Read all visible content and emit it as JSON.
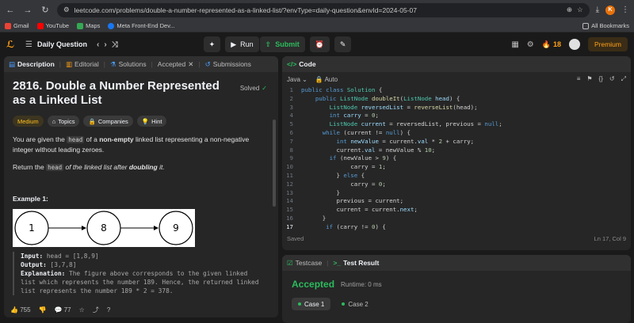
{
  "browser": {
    "url": "leetcode.com/problems/double-a-number-represented-as-a-linked-list/?envType=daily-question&envId=2024-05-07",
    "profile_initial": "K",
    "bookmarks": [
      "Gmail",
      "YouTube",
      "Maps",
      "Meta Front-End Dev..."
    ],
    "all_bookmarks": "All Bookmarks"
  },
  "header": {
    "daily_label": "Daily Question",
    "run_label": "Run",
    "submit_label": "Submit",
    "streak": "18",
    "premium_label": "Premium"
  },
  "left_panel": {
    "tabs": [
      "Description",
      "Editorial",
      "Solutions",
      "Accepted",
      "Submissions"
    ],
    "title": "2816. Double a Number Represented as a Linked List",
    "solved_label": "Solved",
    "tags": [
      "Medium",
      "Topics",
      "Companies",
      "Hint"
    ],
    "para1_a": "You are given the ",
    "para1_code": "head",
    "para1_b": " of a ",
    "para1_bold": "non-empty",
    "para1_c": " linked list representing a non-negative integer without leading zeroes.",
    "para2_a": "Return the ",
    "para2_code": "head",
    "para2_b": " of the linked list after ",
    "para2_bold": "doubling",
    "para2_c": " it.",
    "example_title": "Example 1:",
    "diagram_nodes": [
      "1",
      "8",
      "9"
    ],
    "input_label": "Input:",
    "input_value": " head = [1,8,9]",
    "output_label": "Output:",
    "output_value": " [3,7,8]",
    "explanation_label": "Explanation:",
    "explanation_lines": [
      " The figure above corresponds to the given linked",
      "list which represents the number 189. Hence, the returned linked",
      "list represents the number 189 * 2 = 378."
    ],
    "likes": "755",
    "comments": "77"
  },
  "code_panel": {
    "tab_label": "Code",
    "language": "Java",
    "mode": "Auto",
    "saved_label": "Saved",
    "cursor_pos": "Ln 17, Col 9",
    "current_line": 17
  },
  "test_panel": {
    "tabs": [
      "Testcase",
      "Test Result"
    ],
    "result": "Accepted",
    "runtime": "Runtime: 0 ms",
    "cases": [
      "Case 1",
      "Case 2"
    ]
  }
}
